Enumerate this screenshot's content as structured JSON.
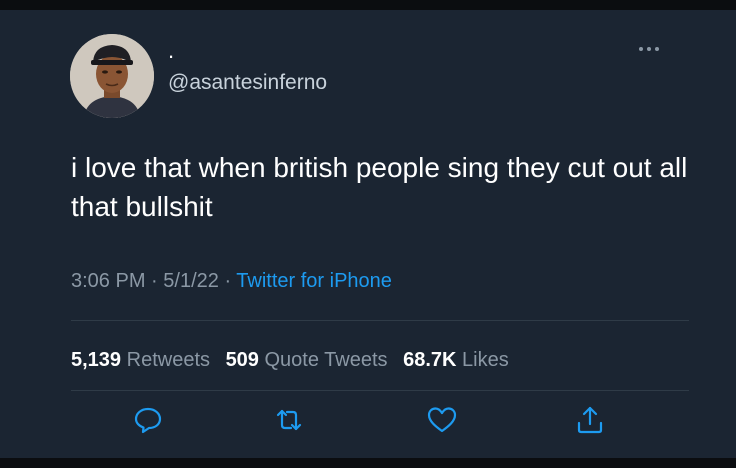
{
  "tweet": {
    "display_name": ".",
    "handle": "@asantesinferno",
    "text": "i love that when british people sing they cut out all that bullshit",
    "time": "3:06 PM",
    "date": "5/1/22",
    "source": "Twitter for iPhone",
    "retweets": "5,139",
    "retweets_label": "Retweets",
    "quote_tweets": "509",
    "quote_tweets_label": "Quote Tweets",
    "likes": "68.7K",
    "likes_label": "Likes"
  },
  "icons": {
    "more": "more-options-icon",
    "reply": "reply-icon",
    "retweet": "retweet-icon",
    "like": "heart-icon",
    "share": "share-icon"
  },
  "colors": {
    "background": "#1b2532",
    "text": "#ffffff",
    "muted": "#8b98a5",
    "link": "#1d9bf0"
  }
}
